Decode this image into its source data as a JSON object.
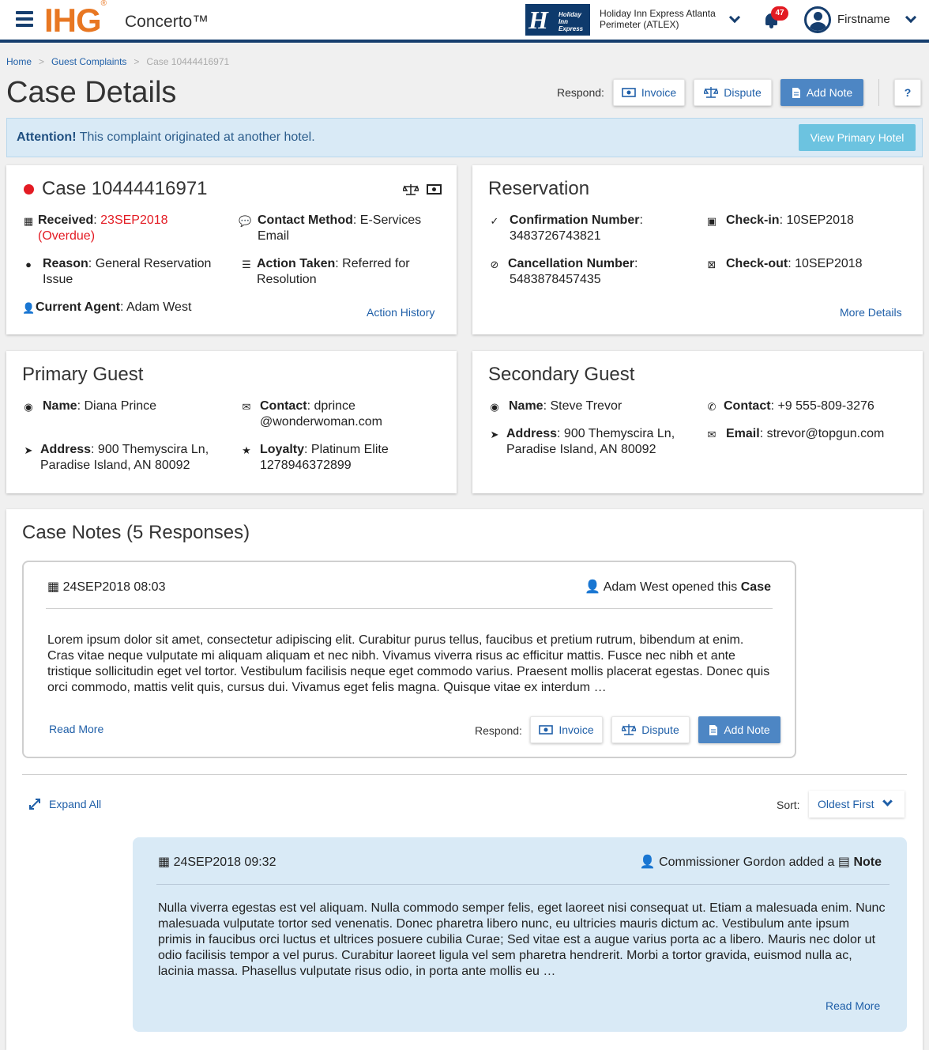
{
  "header": {
    "brand": "IHG",
    "brand_mark": "®",
    "app_name": "Concerto™",
    "hotel_logo_text": "Holiday Inn Express",
    "hotel_line1": "Holiday Inn Express Atlanta",
    "hotel_line2": "Perimeter (ATLEX)",
    "notification_count": "47",
    "user_name": "Firstname"
  },
  "breadcrumb": {
    "home": "Home",
    "section": "Guest Complaints",
    "current": "Case 10444416971"
  },
  "page": {
    "title": "Case Details",
    "respond_label": "Respond:",
    "invoice_label": "Invoice",
    "dispute_label": "Dispute",
    "add_note_label": "Add Note",
    "help_label": "?"
  },
  "alert": {
    "strong": "Attention!",
    "message": " This complaint originated at another hotel.",
    "button": "View Primary Hotel"
  },
  "case": {
    "title": "Case 10444416971",
    "received_label": "Received",
    "received_value": "23SEP2018",
    "received_status": "(Overdue)",
    "contact_method_label": "Contact Method",
    "contact_method_value": "E-Services Email",
    "reason_label": "Reason",
    "reason_value": "General Reservation Issue",
    "action_taken_label": "Action Taken",
    "action_taken_value": "Referred for Resolution",
    "agent_label": "Current Agent",
    "agent_value": "Adam West",
    "history_link": "Action History"
  },
  "reservation": {
    "title": "Reservation",
    "confirmation_label": "Confirmation Number",
    "confirmation_value": "3483726743821",
    "cancellation_label": "Cancellation Number",
    "cancellation_value": "5483878457435",
    "checkin_label": "Check-in",
    "checkin_value": "10SEP2018",
    "checkout_label": "Check-out",
    "checkout_value": "10SEP2018",
    "more_link": "More Details"
  },
  "primary_guest": {
    "title": "Primary Guest",
    "name_label": "Name",
    "name_value": "Diana Prince",
    "contact_label": "Contact",
    "contact_value_1": "dprince",
    "contact_value_2": "@wonderwoman.com",
    "address_label": "Address",
    "address_line1": "900 Themyscira Ln,",
    "address_line2": "Paradise Island, AN 80092",
    "loyalty_label": "Loyalty",
    "loyalty_value": "Platinum Elite",
    "loyalty_number": "1278946372899"
  },
  "secondary_guest": {
    "title": "Secondary Guest",
    "name_label": "Name",
    "name_value": "Steve Trevor",
    "contact_label": "Contact",
    "contact_value": "+9 555-809-3276",
    "address_label": "Address",
    "address_line1": "900 Themyscira Ln,",
    "address_line2": "Paradise Island, AN 80092",
    "email_label": "Email",
    "email_value": "strevor@topgun.com"
  },
  "notes": {
    "title": "Case Notes (5 Responses)",
    "first": {
      "date": "24SEP2018 08:03",
      "author_prefix": "Adam West opened this",
      "author_object": "Case",
      "body": "Lorem ipsum dolor sit amet, consectetur adipiscing elit. Curabitur purus tellus, faucibus et pretium rutrum, bibendum at enim. Cras vitae neque vulputate mi aliquam aliquam et nec nibh. Vivamus viverra risus ac efficitur mattis. Fusce nec nibh et ante tristique sollicitudin eget vel tortor. Vestibulum facilisis neque eget commodo varius. Praesent mollis placerat egestas. Donec quis orci commodo, mattis velit quis, cursus dui. Vivamus eget felis magna. Quisque vitae ex interdum …",
      "read_more": "Read More",
      "respond_label": "Respond:",
      "invoice_label": "Invoice",
      "dispute_label": "Dispute",
      "add_note_label": "Add Note"
    },
    "expand_all": "Expand All",
    "sort_label": "Sort:",
    "sort_value": "Oldest First",
    "reply": {
      "date": "24SEP2018 09:32",
      "author_prefix": "Commissioner Gordon added a",
      "author_object": "Note",
      "body": "Nulla viverra egestas est vel aliquam. Nulla commodo semper felis, eget laoreet nisi consequat ut. Etiam a malesuada enim. Nunc malesuada vulputate tortor sed venenatis. Donec pharetra libero nunc, eu ultricies mauris dictum ac. Vestibulum ante ipsum primis in faucibus orci luctus et ultrices posuere cubilia Curae; Sed vitae est a augue varius porta ac a libero. Mauris nec dolor ut odio facilisis tempor a vel purus. Curabitur laoreet ligula vel sem pharetra hendrerit. Morbi a tortor gravida, euismod nulla ac, lacinia massa. Phasellus vulputate risus odio, in porta ante mollis eu …",
      "read_more": "Read More"
    }
  },
  "colors": {
    "brand_orange": "#e87722",
    "navy": "#163e6e",
    "link_blue": "#1f5fa8",
    "primary_button": "#4d86c4",
    "alert_bg": "#d9eaf6",
    "info_button": "#6cc3e0",
    "overdue_red": "#e31b23"
  },
  "icons": [
    "menu-icon",
    "chevron-down-icon",
    "bell-icon",
    "user-avatar-icon",
    "invoice-icon",
    "dispute-icon",
    "note-icon",
    "calendar-icon",
    "chat-icon",
    "comment-icon",
    "list-icon",
    "user-icon",
    "check-circle-icon",
    "ban-icon",
    "calendar-check-icon",
    "calendar-x-icon",
    "envelope-icon",
    "location-arrow-icon",
    "star-icon",
    "phone-icon",
    "expand-icon",
    "status-dot-icon"
  ]
}
